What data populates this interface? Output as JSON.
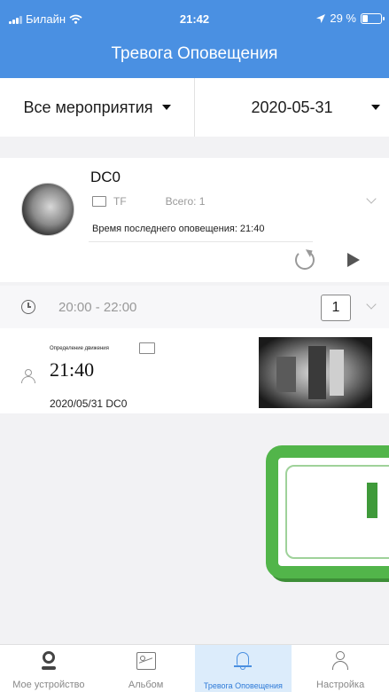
{
  "status_bar": {
    "carrier": "Билайн",
    "time": "21:42",
    "battery_text": "29 %",
    "battery_level": 0.29
  },
  "header": {
    "title": "Тревога Оповещения"
  },
  "filters": {
    "event_filter": "Все мероприятия",
    "date": "2020-05-31"
  },
  "device": {
    "name": "DC0",
    "storage": "TF",
    "total": "Всего: 1",
    "last_alert": "Время последнего оповещения: 21:40"
  },
  "time_range": {
    "label": "20:00 - 22:00",
    "count": "1"
  },
  "event": {
    "type": "Определение движения",
    "time": "21:40",
    "date_device": "2020/05/31   DC0"
  },
  "tabs": [
    {
      "label": "Мое устройство",
      "icon": "camera-icon",
      "active": false
    },
    {
      "label": "Альбом",
      "icon": "album-icon",
      "active": false
    },
    {
      "label": "Тревога Оповещения",
      "icon": "bell-icon",
      "active": true
    },
    {
      "label": "Настройка",
      "icon": "user-icon",
      "active": false
    }
  ],
  "colors": {
    "header_bg": "#4a90e2",
    "active_tab_bg": "#dcecfb",
    "active_tab_text": "#2f7bd8",
    "stamp_green": "#52b54a"
  }
}
